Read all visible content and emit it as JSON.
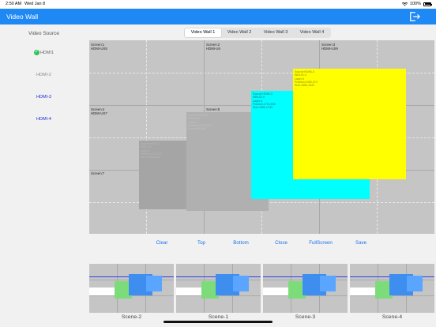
{
  "status": {
    "time": "2:50 AM",
    "date": "Wed Jan 8",
    "battery": "100%"
  },
  "nav": {
    "title": "Video Wall",
    "exit_icon": "exit-icon"
  },
  "sidebar": {
    "header": "Video Source",
    "sources": [
      {
        "label": "HDMI1",
        "checked": true,
        "color": "#6b6b6b"
      },
      {
        "label": "HDMI-2",
        "checked": false,
        "color": "#8a8a8a"
      },
      {
        "label": "HDMI-3",
        "checked": false,
        "color": "#1c2bd6"
      },
      {
        "label": "HDMI-4",
        "checked": false,
        "color": "#1c2bd6"
      }
    ]
  },
  "tabs": [
    "Video Wall 1",
    "Video Wall 2",
    "Video Wall 3",
    "Video Wall 4"
  ],
  "active_tab": 0,
  "screens": [
    {
      "name": "Screen:1",
      "src": "HDMI-US5"
    },
    {
      "name": "Screen:2",
      "src": "HDMI-U6"
    },
    {
      "name": "Screen:3",
      "src": "HDMI-US9"
    },
    {
      "name": "Screen:4",
      "src": "HDMI-US7"
    },
    {
      "name": "Screen:5",
      "src": ""
    },
    {
      "name": "Screen:7",
      "src": ""
    }
  ],
  "windows": [
    {
      "lines": [
        "Source:HDMI-1",
        "WIN-ID:1",
        "Layer:1",
        "Position:176,173",
        "Size:1808,1065"
      ],
      "color": "#a5a5a5",
      "text": "#b8b8b8"
    },
    {
      "lines": [
        "Source:HDMI-2",
        "WIN-ID:2",
        "Layer:2",
        "Position:1014,573",
        "Size:1808,963"
      ],
      "color": "#b0b0b0",
      "text": "#c2c2c2"
    },
    {
      "lines": [
        "Source:HDMI-3",
        "WIN-ID:3",
        "Layer:3",
        "Position:1716,650",
        "Size:1960,1733"
      ],
      "color": "#00ffff",
      "text": "#2a6a74"
    },
    {
      "lines": [
        "Source:HDMI-4",
        "WIN-ID:4",
        "Layer:4",
        "Position:2450,474",
        "Size:1880,1633"
      ],
      "color": "#ffff00",
      "text": "#8a8a00"
    }
  ],
  "actions": [
    "Clear",
    "Top",
    "Bottom",
    "Close",
    "FullScreen",
    "Save"
  ],
  "scenes": [
    "Scene-2",
    "Scene-1",
    "Scene-3",
    "Scene-4"
  ],
  "colors": {
    "accent": "#1e88f5",
    "link": "#1d73e8"
  }
}
